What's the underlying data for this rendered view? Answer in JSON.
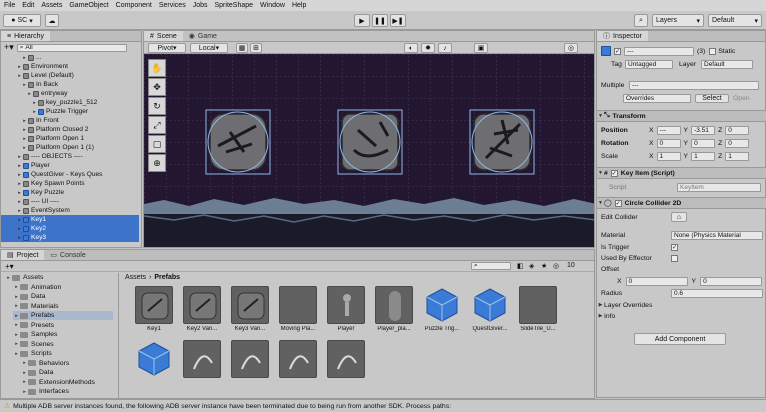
{
  "menu": [
    "File",
    "Edit",
    "Assets",
    "GameObject",
    "Component",
    "Services",
    "Jobs",
    "SpriteShape",
    "Window",
    "Help"
  ],
  "toolbar": {
    "account": "SC",
    "layers": "Layers",
    "layout": "Default"
  },
  "hierarchy": {
    "tab": "Hierarchy",
    "search_prefix": "All",
    "rows": [
      {
        "label": "...",
        "indent": 4,
        "icon": "cube",
        "sel": false
      },
      {
        "label": "Environment",
        "indent": 3,
        "icon": "cube",
        "sel": false
      },
      {
        "label": "Level (Default)",
        "indent": 3,
        "icon": "cube",
        "sel": false
      },
      {
        "label": "In Back",
        "indent": 4,
        "icon": "cube",
        "sel": false
      },
      {
        "label": "entryway",
        "indent": 5,
        "icon": "cube",
        "sel": false
      },
      {
        "label": "key_puzzle1_512",
        "indent": 6,
        "icon": "cube",
        "sel": false
      },
      {
        "label": "Puzzle Trigger",
        "indent": 6,
        "icon": "blue",
        "sel": false
      },
      {
        "label": "In Front",
        "indent": 4,
        "icon": "cube",
        "sel": false
      },
      {
        "label": "Platform Closed 2",
        "indent": 4,
        "icon": "cube",
        "sel": false
      },
      {
        "label": "Platform Open 1",
        "indent": 4,
        "icon": "cube",
        "sel": false
      },
      {
        "label": "Platform Open 1 (1)",
        "indent": 4,
        "icon": "cube",
        "sel": false
      },
      {
        "label": "---- OBJECTS ----",
        "indent": 3,
        "icon": "cube",
        "sel": false
      },
      {
        "label": "Player",
        "indent": 3,
        "icon": "blue",
        "sel": false
      },
      {
        "label": "QuestGiver - Keys Ques",
        "indent": 3,
        "icon": "blue",
        "sel": false
      },
      {
        "label": "Key Spawn Points",
        "indent": 3,
        "icon": "cube",
        "sel": false
      },
      {
        "label": "Key Puzzle",
        "indent": 3,
        "icon": "blue",
        "sel": false
      },
      {
        "label": "---- UI ----",
        "indent": 3,
        "icon": "cube",
        "sel": false
      },
      {
        "label": "EventSystem",
        "indent": 3,
        "icon": "cube",
        "sel": false
      },
      {
        "label": "Key1",
        "indent": 3,
        "icon": "blue",
        "sel": true
      },
      {
        "label": "Key2",
        "indent": 3,
        "icon": "blue",
        "sel": true
      },
      {
        "label": "Key3",
        "indent": 3,
        "icon": "blue",
        "sel": true
      }
    ]
  },
  "scene": {
    "tab_scene": "Scene",
    "tab_game": "Game",
    "pivot": "Pivot",
    "local": "Local"
  },
  "inspector": {
    "tab": "Inspector",
    "name": "---",
    "count": "(3)",
    "static_label": "Static",
    "tag_label": "Tag",
    "tag_value": "Untagged",
    "layer_label": "Layer",
    "layer_value": "Default",
    "multiple_label": "Multiple",
    "multiple_value": "---",
    "overrides": "Overrides",
    "select": "Select",
    "open": "Open",
    "transform": "Transform",
    "position": "Position",
    "pos_x": "---",
    "pos_y": "-3.51",
    "pos_z": "0",
    "rotation": "Rotation",
    "rot_x": "0",
    "rot_y": "0",
    "rot_z": "0",
    "scale": "Scale",
    "sc_x": "1",
    "sc_y": "1",
    "sc_z": "1",
    "key_item": "Key Item (Script)",
    "script_label": "Script",
    "script_value": "KeyItem",
    "circle": "Circle Collider 2D",
    "edit_collider": "Edit Collider",
    "material": "Material",
    "material_value": "None (Physics Material",
    "is_trigger": "Is Trigger",
    "used_by_effector": "Used By Effector",
    "offset": "Offset",
    "off_x": "0",
    "off_y": "0",
    "radius": "Radius",
    "radius_value": "0.6",
    "layer_overrides": "Layer Overrides",
    "info": "Info",
    "add_component": "Add Component"
  },
  "project": {
    "tab_project": "Project",
    "tab_console": "Console",
    "tree": [
      {
        "label": "Assets",
        "indent": 0
      },
      {
        "label": "Animation",
        "indent": 1
      },
      {
        "label": "Data",
        "indent": 1
      },
      {
        "label": "Materials",
        "indent": 1
      },
      {
        "label": "Prefabs",
        "indent": 1
      },
      {
        "label": "Presets",
        "indent": 1
      },
      {
        "label": "Samples",
        "indent": 1
      },
      {
        "label": "Scenes",
        "indent": 1
      },
      {
        "label": "Scripts",
        "indent": 1
      },
      {
        "label": "Behaviors",
        "indent": 2
      },
      {
        "label": "Data",
        "indent": 2
      },
      {
        "label": "ExtensionMethods",
        "indent": 2
      },
      {
        "label": "Interfaces",
        "indent": 2
      }
    ],
    "breadcrumb_root": "Assets",
    "breadcrumb_sep": "›",
    "breadcrumb_current": "Prefabs",
    "count": "10",
    "assets": [
      "Key1",
      "Key2 Vari...",
      "Key3 Vari...",
      "Moving Pla...",
      "Player",
      "Player_pla...",
      "Puzzle Trig...",
      "QuestGiver...",
      "SlideTile_U..."
    ]
  },
  "status": "Multiple ADB server instances found, the following ADB server instance have been terminated due to being run from another SDK. Process paths:"
}
